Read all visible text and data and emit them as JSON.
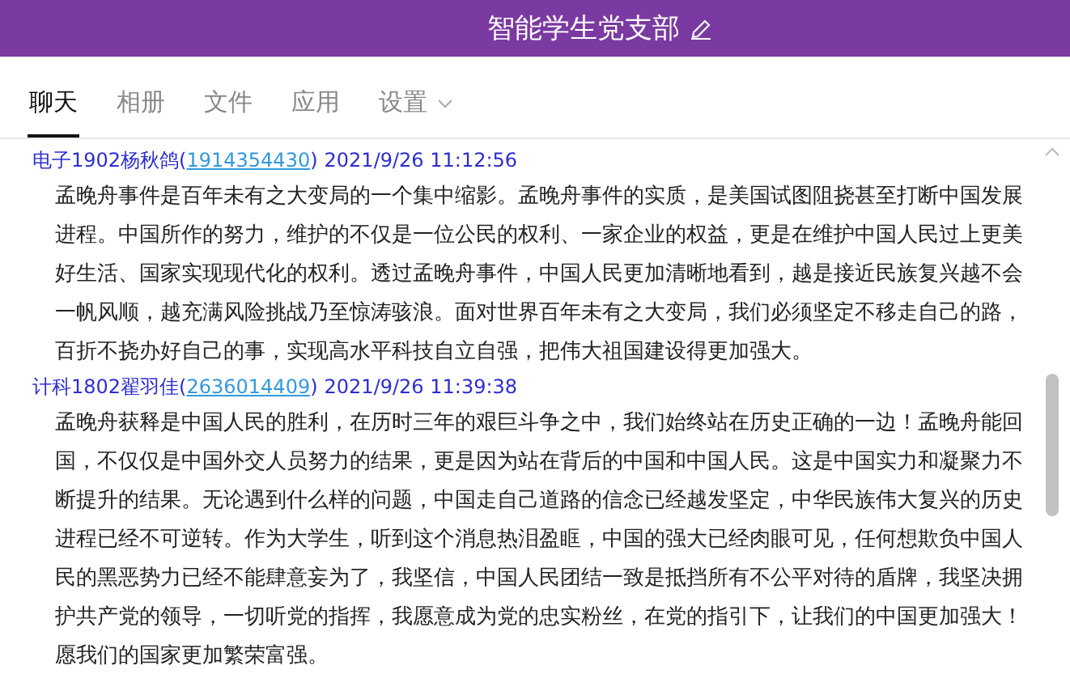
{
  "window": {
    "title": "智能学生党支部"
  },
  "tabs": [
    {
      "label": "聊天",
      "selected": true,
      "kind": "tab"
    },
    {
      "label": "相册",
      "selected": false,
      "kind": "tab"
    },
    {
      "label": "文件",
      "selected": false,
      "kind": "tab"
    },
    {
      "label": "应用",
      "selected": false,
      "kind": "tab"
    },
    {
      "label": "设置",
      "selected": false,
      "kind": "dropdown"
    }
  ],
  "messages": [
    {
      "sender": "电子1902杨秋鸽(",
      "qq": "1914354430",
      "qq_close": ")",
      "time": "2021/9/26 11:12:56",
      "text": "孟晚舟事件是百年未有之大变局的一个集中缩影。孟晚舟事件的实质，是美国试图阻挠甚至打断中国发展进程。中国所作的努力，维护的不仅是一位公民的权利、一家企业的权益，更是在维护中国人民过上更美好生活、国家实现现代化的权利。透过孟晚舟事件，中国人民更加清晰地看到，越是接近民族复兴越不会一帆风顺，越充满风险挑战乃至惊涛骇浪。面对世界百年未有之大变局，我们必须坚定不移走自己的路，百折不挠办好自己的事，实现高水平科技自立自强，把伟大祖国建设得更加强大。"
    },
    {
      "sender": "计科1802翟羽佳(",
      "qq": "2636014409",
      "qq_close": ")",
      "time": "2021/9/26 11:39:38",
      "text": "孟晚舟获释是中国人民的胜利，在历时三年的艰巨斗争之中，我们始终站在历史正确的一边！孟晚舟能回国，不仅仅是中国外交人员努力的结果，更是因为站在背后的中国和中国人民。这是中国实力和凝聚力不断提升的结果。无论遇到什么样的问题，中国走自己道路的信念已经越发坚定，中华民族伟大复兴的历史进程已经不可逆转。作为大学生，听到这个消息热泪盈眶，中国的强大已经肉眼可见，任何想欺负中国人民的黑恶势力已经不能肆意妄为了，我坚信，中国人民团结一致是抵挡所有不公平对待的盾牌，我坚决拥护共产党的领导，一切听党的指挥，我愿意成为党的忠实粉丝，在党的指引下，让我们的中国更加强大！愿我们的国家更加繁荣富强。"
    }
  ]
}
